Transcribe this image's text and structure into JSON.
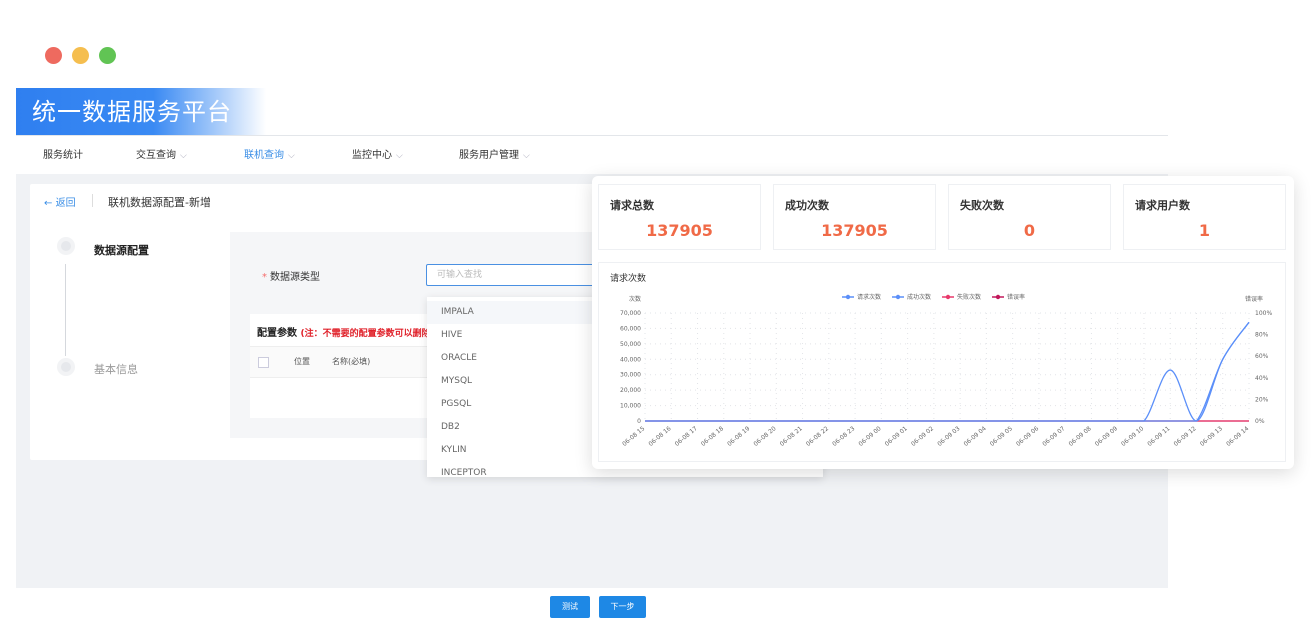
{
  "window": {
    "dot_colors": [
      "#ee6a5f",
      "#f5be4f",
      "#61c454"
    ]
  },
  "app": {
    "title": "统一数据服务平台"
  },
  "nav": [
    {
      "label": "服务统计",
      "dropdown": false,
      "active": false
    },
    {
      "label": "交互查询",
      "dropdown": true,
      "active": false
    },
    {
      "label": "联机查询",
      "dropdown": true,
      "active": true
    },
    {
      "label": "监控中心",
      "dropdown": true,
      "active": false
    },
    {
      "label": "服务用户管理",
      "dropdown": true,
      "active": false
    }
  ],
  "page": {
    "back_label": "返回",
    "breadcrumb": "联机数据源配置-新增"
  },
  "steps": [
    {
      "label": "数据源配置",
      "active": true
    },
    {
      "label": "基本信息",
      "active": false
    }
  ],
  "form": {
    "datasource_type_label": "数据源类型",
    "datasource_type_placeholder": "可输入查找",
    "params_title": "配置参数",
    "params_note": "(注：不需要的配置参数可以删除",
    "columns": [
      "位置",
      "名称(必填)"
    ]
  },
  "dropdown": {
    "options": [
      "IMPALA",
      "HIVE",
      "ORACLE",
      "MYSQL",
      "PGSQL",
      "DB2",
      "KYLIN",
      "INCEPTOR"
    ],
    "highlighted": "IMPALA"
  },
  "stats": [
    {
      "label": "请求总数",
      "value": "137905"
    },
    {
      "label": "成功次数",
      "value": "137905"
    },
    {
      "label": "失败次数",
      "value": "0"
    },
    {
      "label": "请求用户数",
      "value": "1"
    }
  ],
  "chart_data": {
    "type": "line",
    "title": "请求次数",
    "ylabel": "次数",
    "ylabel_right": "错误率",
    "ylim": [
      0,
      70000
    ],
    "y_ticks": [
      "0",
      "10,000",
      "20,000",
      "30,000",
      "40,000",
      "50,000",
      "60,000",
      "70,000"
    ],
    "y2_ticks": [
      "0%",
      "20%",
      "40%",
      "60%",
      "80%",
      "100%"
    ],
    "legend_position": "top-center",
    "grid": true,
    "categories": [
      "06-08 15",
      "06-08 16",
      "06-08 17",
      "06-08 18",
      "06-08 19",
      "06-08 20",
      "06-08 21",
      "06-08 22",
      "06-08 23",
      "06-09 00",
      "06-09 01",
      "06-09 02",
      "06-09 03",
      "06-09 04",
      "06-09 05",
      "06-09 06",
      "06-09 07",
      "06-09 08",
      "06-09 09",
      "06-09 10",
      "06-09 11",
      "06-09 12",
      "06-09 13",
      "06-09 14"
    ],
    "series": [
      {
        "name": "请求次数",
        "color": "#5b8ff9",
        "values": [
          0,
          0,
          0,
          0,
          0,
          0,
          0,
          0,
          0,
          0,
          0,
          0,
          0,
          0,
          0,
          0,
          0,
          0,
          0,
          0,
          0,
          0,
          40000,
          64000
        ]
      },
      {
        "name": "成功次数",
        "color": "#5b8ff9",
        "values": [
          0,
          0,
          0,
          0,
          0,
          0,
          0,
          0,
          0,
          0,
          0,
          0,
          0,
          0,
          0,
          0,
          0,
          0,
          0,
          0,
          33000,
          0,
          40000,
          64000
        ]
      },
      {
        "name": "失败次数",
        "color": "#e8396b",
        "values": [
          0,
          0,
          0,
          0,
          0,
          0,
          0,
          0,
          0,
          0,
          0,
          0,
          0,
          0,
          0,
          0,
          0,
          0,
          0,
          0,
          0,
          0,
          0,
          0
        ]
      },
      {
        "name": "错误率",
        "color": "#c2185b",
        "values": [
          0,
          0,
          0,
          0,
          0,
          0,
          0,
          0,
          0,
          0,
          0,
          0,
          0,
          0,
          0,
          0,
          0,
          0,
          0,
          0,
          0,
          0,
          0,
          0
        ]
      }
    ]
  },
  "buttons": {
    "test_label": "测试",
    "next_label": "下一步"
  }
}
